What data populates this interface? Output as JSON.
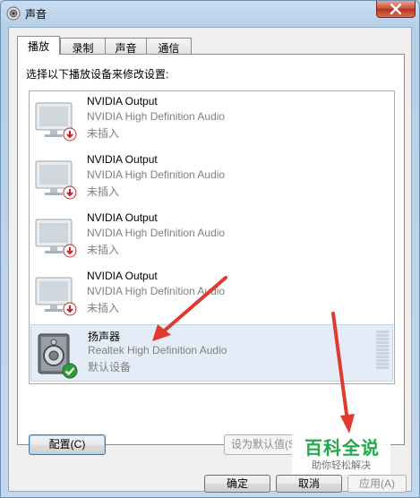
{
  "window": {
    "title": "声音",
    "accent_color": "#c94a33",
    "title_icon": "speaker-icon",
    "close_icon": "close-icon"
  },
  "tabs": [
    {
      "label": "播放",
      "active": true
    },
    {
      "label": "录制",
      "active": false
    },
    {
      "label": "声音",
      "active": false
    },
    {
      "label": "通信",
      "active": false
    }
  ],
  "instruction": "选择以下播放设备来修改设置:",
  "devices": [
    {
      "name": "NVIDIA Output",
      "description": "NVIDIA High Definition Audio",
      "status": "未插入",
      "icon": "monitor-icon",
      "badge": "unplugged-badge-icon",
      "selected": false
    },
    {
      "name": "NVIDIA Output",
      "description": "NVIDIA High Definition Audio",
      "status": "未插入",
      "icon": "monitor-icon",
      "badge": "unplugged-badge-icon",
      "selected": false
    },
    {
      "name": "NVIDIA Output",
      "description": "NVIDIA High Definition Audio",
      "status": "未插入",
      "icon": "monitor-icon",
      "badge": "unplugged-badge-icon",
      "selected": false
    },
    {
      "name": "NVIDIA Output",
      "description": "NVIDIA High Definition Audio",
      "status": "未插入",
      "icon": "monitor-icon",
      "badge": "unplugged-badge-icon",
      "selected": false
    },
    {
      "name": "扬声器",
      "description": "Realtek High Definition Audio",
      "status": "默认设备",
      "icon": "speaker-device-icon",
      "badge": "default-check-icon",
      "selected": true
    }
  ],
  "buttons": {
    "configure": "配置(C)",
    "set_default": "设为默认值(S)",
    "ok": "确定",
    "cancel": "取消",
    "apply": "应用(A)"
  },
  "watermark": {
    "title": "百科全说",
    "subtitle": "助你轻松解决",
    "color": "#23a84a"
  },
  "annotation": {
    "arrow_color": "#e03a2e"
  }
}
